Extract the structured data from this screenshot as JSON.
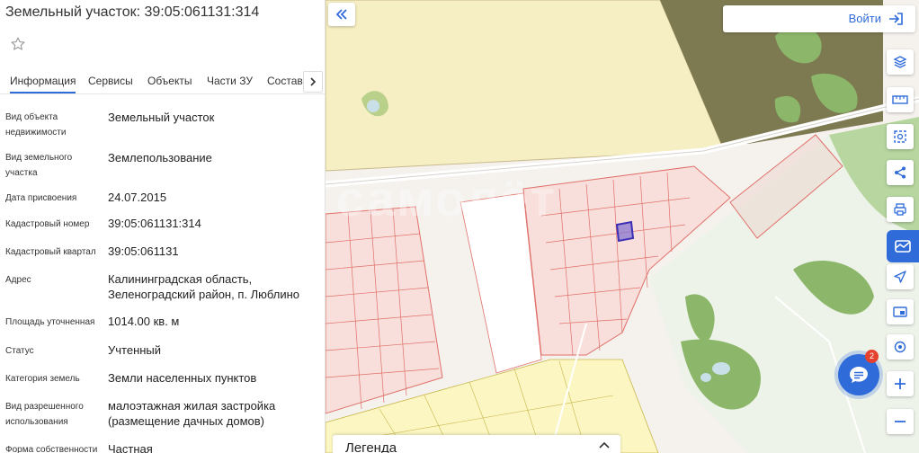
{
  "title": "Земельный участок: 39:05:061131:314",
  "tabs": [
    "Информация",
    "Сервисы",
    "Объекты",
    "Части ЗУ",
    "Состав"
  ],
  "rows": [
    {
      "label": "Вид объекта недвижимости",
      "value": "Земельный участок"
    },
    {
      "label": "Вид земельного участка",
      "value": "Землепользование"
    },
    {
      "label": "Дата присвоения",
      "value": "24.07.2015"
    },
    {
      "label": "Кадастровый номер",
      "value": "39:05:061131:314"
    },
    {
      "label": "Кадастровый квартал",
      "value": "39:05:061131"
    },
    {
      "label": "Адрес",
      "value": "Калининградская область, Зеленоградский район, п. Люблино"
    },
    {
      "label": "Площадь уточненная",
      "value": "1014.00 кв. м"
    },
    {
      "label": "Статус",
      "value": "Учтенный"
    },
    {
      "label": "Категория земель",
      "value": "Земли населенных пунктов"
    },
    {
      "label": "Вид разрешенного использования",
      "value": "малоэтажная жилая застройка (размещение дачных домов)"
    },
    {
      "label": "Форма собственности",
      "value": "Частная"
    }
  ],
  "map": {
    "login_label": "Войти",
    "legend_label": "Легенда",
    "chat_badge": "2",
    "watermark": "самолёт"
  },
  "icons": {
    "favorite": "star-icon",
    "collapse": "double-chevron-left-icon",
    "login": "sign-in-icon",
    "tools": [
      "layers-icon",
      "ruler-icon",
      "area-select-icon",
      "share-icon",
      "print-icon",
      "cadastre-icon",
      "navigate-icon",
      "minimap-icon",
      "location-icon",
      "zoom-in-icon",
      "zoom-out-icon"
    ],
    "chat": "chat-icon"
  },
  "colors": {
    "accent": "#2f6bd9",
    "parcel_line": "#e0706a",
    "forest": "#8cb76a",
    "cadastral_zone": "#f6efc3",
    "selected_parcel": "#7f6fd0"
  }
}
